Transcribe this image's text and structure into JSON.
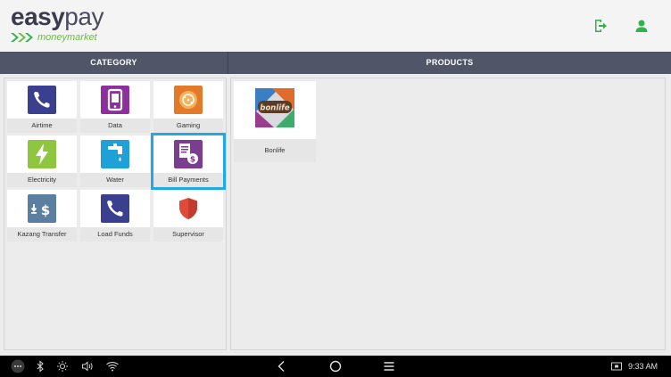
{
  "header": {
    "logo_bold": "easy",
    "logo_thin": "pay",
    "logo_sub": "moneymarket",
    "logout_icon": "logout-icon",
    "user_icon": "user-icon",
    "accent_color": "#2fb34a"
  },
  "columns": {
    "category": "CATEGORY",
    "products": "PRODUCTS"
  },
  "categories": [
    {
      "label": "Airtime",
      "icon": "phone-icon",
      "color": "#3a3f8f"
    },
    {
      "label": "Data",
      "icon": "mobile-data-icon",
      "color": "#8e2f9e"
    },
    {
      "label": "Gaming",
      "icon": "gaming-icon",
      "color": "#e27a2a"
    },
    {
      "label": "Electricity",
      "icon": "lightning-icon",
      "color": "#8ec63f"
    },
    {
      "label": "Water",
      "icon": "water-tap-icon",
      "color": "#1da1d8"
    },
    {
      "label": "Bill Payments",
      "icon": "bill-payment-icon",
      "color": "#7a3d8f",
      "selected": true
    },
    {
      "label": "Kazang Transfer",
      "icon": "transfer-icon",
      "color": "#5a7fa0"
    },
    {
      "label": "Load Funds",
      "icon": "phone-icon",
      "color": "#3a3f8f"
    },
    {
      "label": "Supervisor",
      "icon": "shield-icon",
      "color": "#e04a3a"
    }
  ],
  "products": [
    {
      "label": "Bonlife",
      "logo_text": "bonlife"
    }
  ],
  "navbar": {
    "time": "9:33 AM"
  }
}
